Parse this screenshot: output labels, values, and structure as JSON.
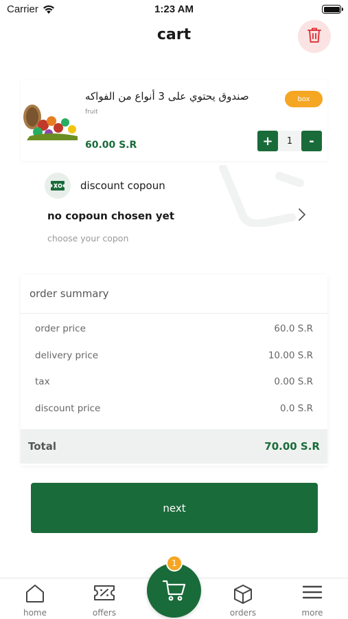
{
  "status_bar": {
    "carrier": "Carrier",
    "time": "1:23 AM"
  },
  "header": {
    "title": "cart"
  },
  "cart_item": {
    "name": "صندوق يحتوي على 3 أنواع من الفواكه",
    "category": "fruit",
    "price": "60.00 S.R",
    "tag": "box",
    "quantity": "1",
    "plus_label": "+",
    "minus_label": "-"
  },
  "discount": {
    "heading": "discount copoun",
    "chosen": "no copoun chosen yet",
    "hint": "choose your copon"
  },
  "summary": {
    "title": "order summary",
    "rows": [
      {
        "label": "order price",
        "value": "60.0 S.R"
      },
      {
        "label": "delivery price",
        "value": "10.00 S.R"
      },
      {
        "label": "tax",
        "value": "0.00 S.R"
      },
      {
        "label": "discount price",
        "value": "0.0 S.R"
      }
    ],
    "total_label": "Total",
    "total_value": "70.00 S.R"
  },
  "next_label": "next",
  "nav": {
    "items": [
      {
        "label": "home",
        "icon": "home-icon"
      },
      {
        "label": "offers",
        "icon": "ticket-icon"
      },
      {
        "label": "orders",
        "icon": "box-icon"
      },
      {
        "label": "more",
        "icon": "menu-icon"
      }
    ],
    "cart_badge": "1"
  },
  "colors": {
    "primary": "#1a6b3a",
    "accent": "#f5a623",
    "danger_bg": "#fbe3e3"
  }
}
